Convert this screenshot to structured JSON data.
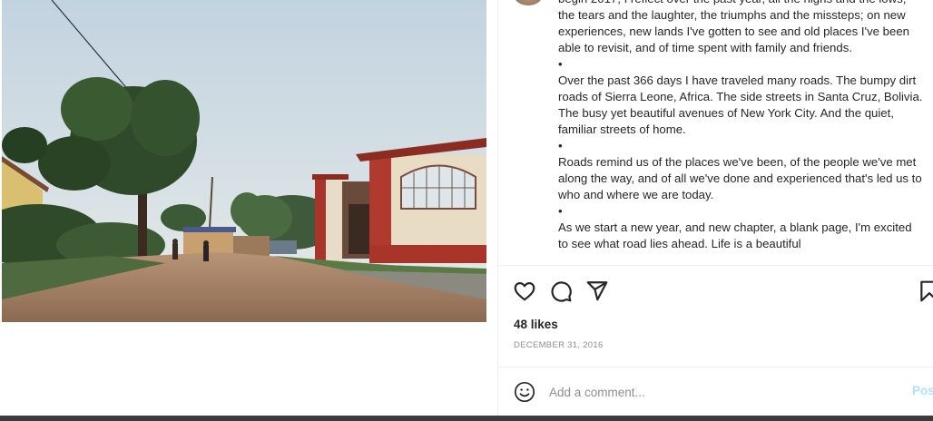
{
  "post": {
    "caption": [
      "begin 2017, I reflect over the past year, all the highs and the lows, the tears and the laughter, the triumphs and the missteps; on new experiences, new lands I've gotten to see and old places I've been able to revisit, and of time spent with family and friends.",
      "•",
      "Over the past 366 days I have traveled many roads. The bumpy dirt roads of Sierra Leone, Africa. The side streets in Santa Cruz, Bolivia. The busy yet beautiful avenues of New York City. And the quiet, familiar streets of home.",
      "•",
      "Roads remind us of the places we've been, of the people we've met along the way, and of all we've done and experienced that's led us to who and where we are today.",
      "•",
      "As we start a new year, and new chapter, a blank page, I'm excited to see what road lies ahead. Life is a beautiful"
    ],
    "likes": "48 likes",
    "date": "DECEMBER 31, 2016"
  },
  "actions": {
    "like_icon": "heart-icon",
    "comment_icon": "comment-icon",
    "share_icon": "paper-plane-icon",
    "save_icon": "bookmark-icon"
  },
  "comment": {
    "emoji_icon": "smiley-icon",
    "placeholder": "Add a comment...",
    "post_label": "Post"
  },
  "colors": {
    "post_button": "#b2dffc",
    "muted_text": "#8e8e8e",
    "divider": "#efefef"
  }
}
